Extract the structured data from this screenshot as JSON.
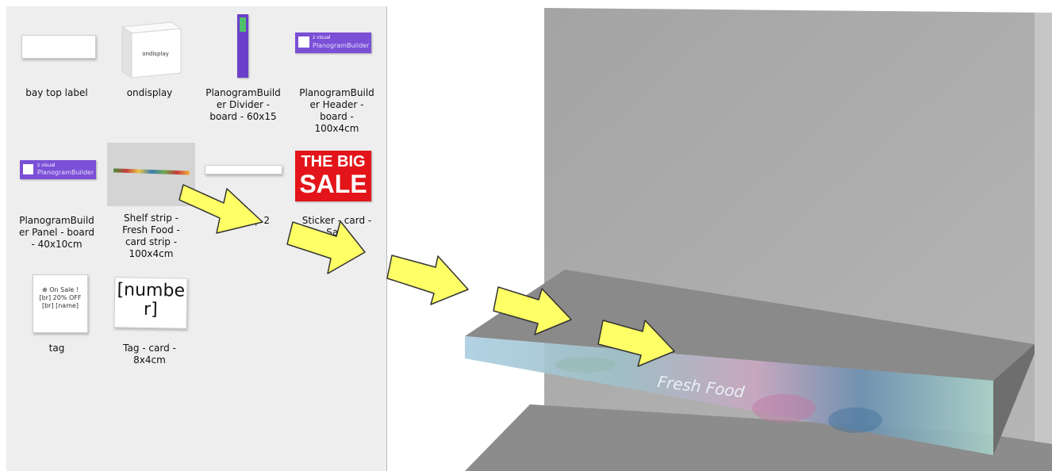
{
  "library": {
    "items": [
      {
        "label": "bay top label"
      },
      {
        "label": "ondisplay",
        "thumb_text": "ondisplay"
      },
      {
        "label": "PlanogramBuild\ner Divider -\nboard - 60x15"
      },
      {
        "label": "PlanogramBuild\ner Header -\nboard -\n100x4cm",
        "thumb_text": "PlanogramBuilder",
        "thumb_brand": "z visual"
      },
      {
        "label": "PlanogramBuild\ner Panel - board\n- 40x10cm",
        "thumb_text": "PlanogramBuilder",
        "thumb_brand": "z visual"
      },
      {
        "label": "Shelf strip -\nFresh Food -\ncard strip -\n100x4cm"
      },
      {
        "label": "p 2"
      },
      {
        "label": "Sticker - card -\nSal -",
        "thumb_text_1": "THE BIG",
        "thumb_text_2": "SALE"
      },
      {
        "label": "tag",
        "thumb_text": "⊕ On Sale !\n[br] 20% OFF\n[br] [name]"
      },
      {
        "label": "Tag - card -\n8x4cm",
        "thumb_text": "[numbe\nr]"
      }
    ]
  },
  "viewport": {
    "strip_text": "Fresh Food"
  },
  "colors": {
    "panel_bg": "#eeeeee",
    "selected_bg": "#d4d4d4",
    "arrow_fill": "#ffff66",
    "shelf_top": "#8a8a8a",
    "back_panel": "#a8a8a8",
    "planogram_purple": "#7b4fd6",
    "sale_red": "#e3151a"
  },
  "icons": [
    "drag-arrow-icon"
  ]
}
